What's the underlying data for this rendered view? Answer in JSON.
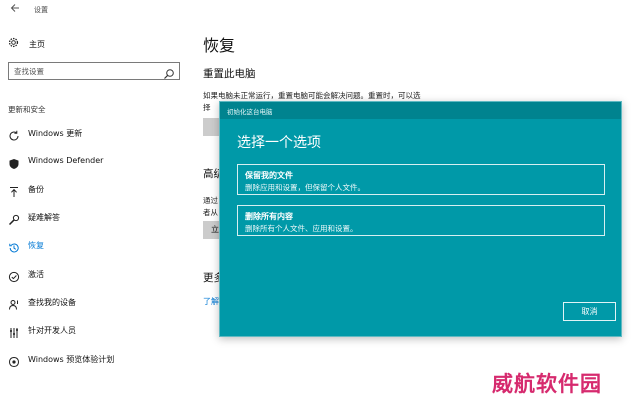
{
  "window": {
    "title": "设置",
    "back_icon": "back-arrow-icon"
  },
  "sidebar": {
    "home_label": "主页",
    "search_placeholder": "查找设置",
    "section_label": "更新和安全",
    "items": [
      {
        "label": "Windows 更新",
        "icon": "sync-icon"
      },
      {
        "label": "Windows Defender",
        "icon": "shield-icon"
      },
      {
        "label": "备份",
        "icon": "upload-arrow-icon"
      },
      {
        "label": "疑难解答",
        "icon": "wrench-icon"
      },
      {
        "label": "恢复",
        "icon": "history-icon",
        "active": true
      },
      {
        "label": "激活",
        "icon": "check-circle-icon"
      },
      {
        "label": "查找我的设备",
        "icon": "person-location-icon"
      },
      {
        "label": "针对开发人员",
        "icon": "developer-tools-icon"
      },
      {
        "label": "Windows 预览体验计划",
        "icon": "insider-icon"
      }
    ]
  },
  "main": {
    "title": "恢复",
    "reset_heading": "重置此电脑",
    "reset_desc_line1": "如果电脑未正常运行，重置电脑可能会解决问题。重置时，可以选",
    "reset_desc_line2": "择",
    "advanced_heading": "高级",
    "advanced_desc_line1": "通过",
    "advanced_desc_line2": "者从",
    "advanced_button": "立",
    "more_heading": "更多",
    "more_link": "了解"
  },
  "dialog": {
    "title": "初始化这台电脑",
    "heading": "选择一个选项",
    "options": [
      {
        "title": "保留我的文件",
        "desc": "删除应用和设置，但保留个人文件。"
      },
      {
        "title": "删除所有内容",
        "desc": "删除所有个人文件、应用和设置。"
      }
    ],
    "cancel_label": "取消"
  },
  "watermark": "威航软件园",
  "colors": {
    "accent": "#0078d4",
    "dialog_bg": "#0099a8",
    "dialog_titlebar": "#00838f",
    "watermark": "#d62a6e"
  }
}
